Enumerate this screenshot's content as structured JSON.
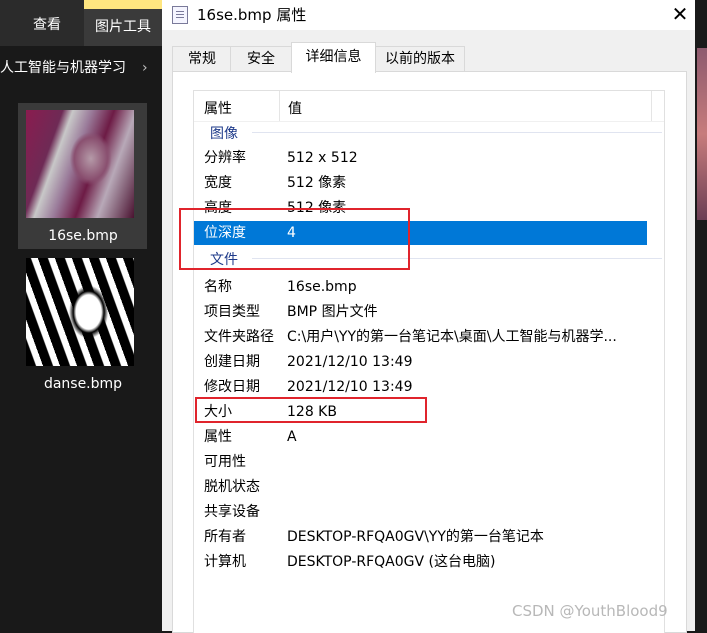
{
  "explorer": {
    "ribbon_tabs": [
      "查看",
      "图片工具"
    ],
    "breadcrumb": "人工智能与机器学习",
    "files": [
      {
        "name": "16se.bmp",
        "selected": true
      },
      {
        "name": "danse.bmp",
        "selected": false
      }
    ]
  },
  "window": {
    "title": "16se.bmp 属性",
    "close_label": "✕",
    "tabs": [
      {
        "label": "常规",
        "active": false
      },
      {
        "label": "安全",
        "active": false
      },
      {
        "label": "详细信息",
        "active": true
      },
      {
        "label": "以前的版本",
        "active": false
      }
    ],
    "columns": {
      "property": "属性",
      "value": "值"
    },
    "groups": {
      "image": {
        "title": "图像",
        "rows": [
          {
            "key": "分辨率",
            "value": "512 x 512"
          },
          {
            "key": "宽度",
            "value": "512 像素"
          },
          {
            "key": "高度",
            "value": "512 像素"
          },
          {
            "key": "位深度",
            "value": "4",
            "selected": true
          }
        ]
      },
      "file": {
        "title": "文件",
        "rows": [
          {
            "key": "名称",
            "value": "16se.bmp"
          },
          {
            "key": "项目类型",
            "value": "BMP 图片文件"
          },
          {
            "key": "文件夹路径",
            "value": "C:\\用户\\YY的第一台笔记本\\桌面\\人工智能与机器学..."
          },
          {
            "key": "创建日期",
            "value": "2021/12/10 13:49"
          },
          {
            "key": "修改日期",
            "value": "2021/12/10 13:49"
          },
          {
            "key": "大小",
            "value": "128 KB"
          },
          {
            "key": "属性",
            "value": "A"
          },
          {
            "key": "可用性",
            "value": ""
          },
          {
            "key": "脱机状态",
            "value": ""
          },
          {
            "key": "共享设备",
            "value": ""
          },
          {
            "key": "所有者",
            "value": "DESKTOP-RFQA0GV\\YY的第一台笔记本"
          },
          {
            "key": "计算机",
            "value": "DESKTOP-RFQA0GV (这台电脑)"
          }
        ]
      }
    }
  },
  "watermark": "CSDN @YouthBlood9",
  "colors": {
    "selection": "#0078d7",
    "annotation": "#e0242c",
    "group_title": "#1e3a8a"
  }
}
